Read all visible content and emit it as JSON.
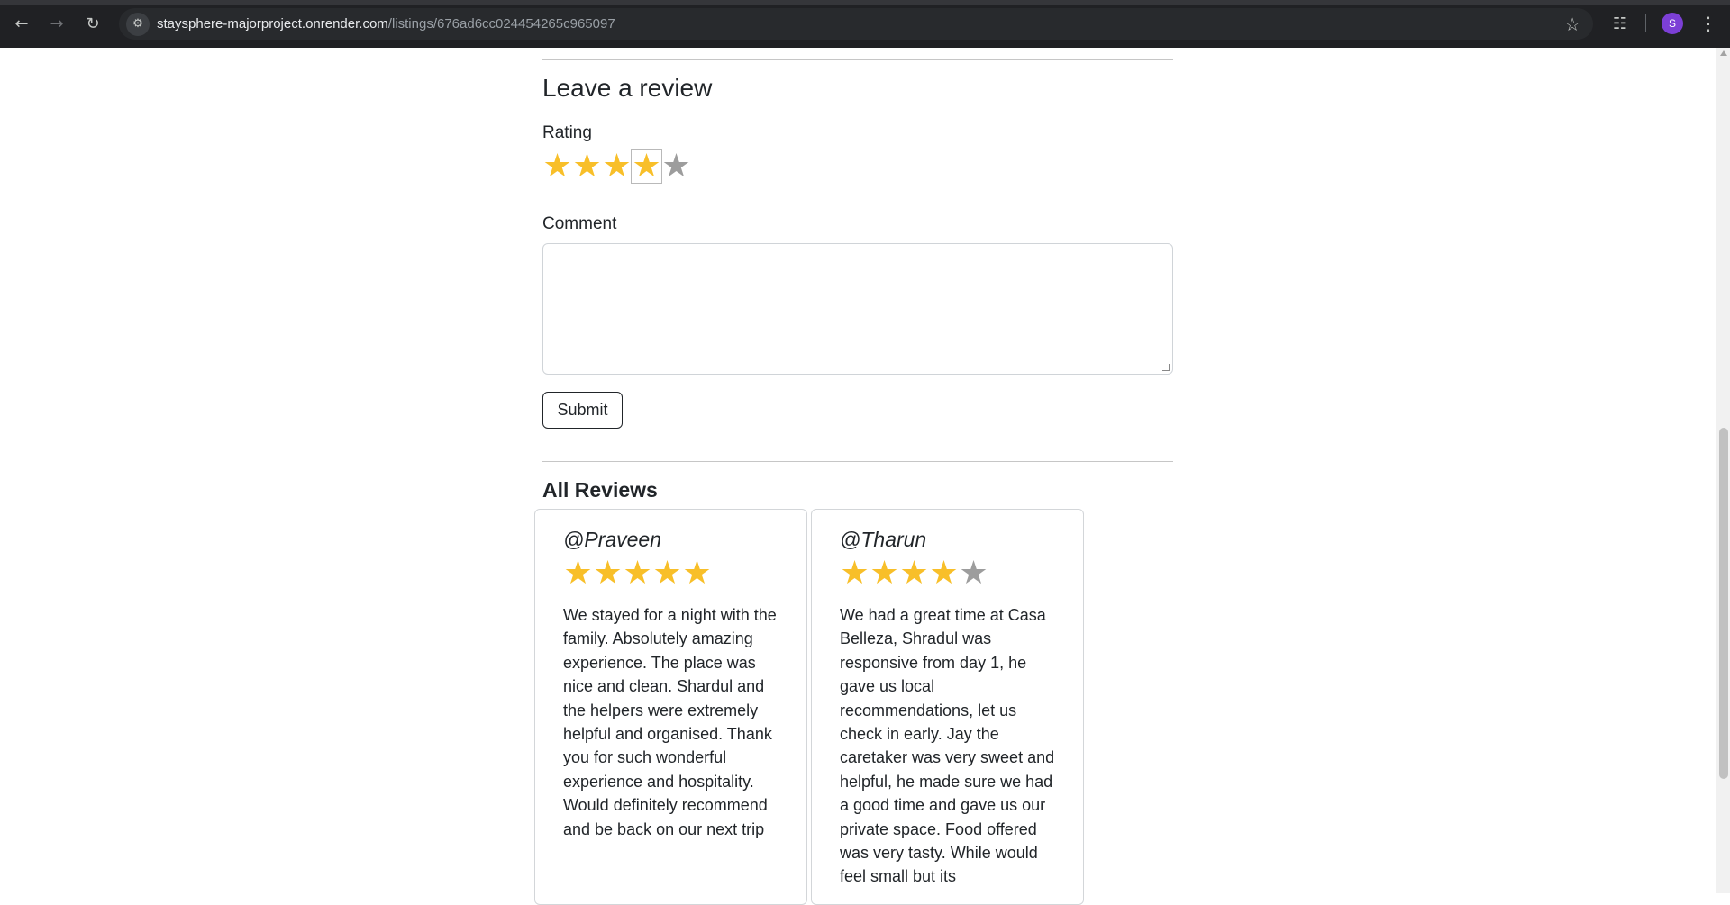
{
  "browser": {
    "url_host": "staysphere-majorproject.onrender.com",
    "url_path": "/listings/676ad6cc024454265c965097",
    "profile_initial": "S"
  },
  "review_form": {
    "heading": "Leave a review",
    "rating_label": "Rating",
    "rating_value": 4,
    "rating_max": 5,
    "comment_label": "Comment",
    "comment_value": "",
    "submit_label": "Submit"
  },
  "reviews_section": {
    "heading": "All Reviews",
    "reviews": [
      {
        "author": "@Praveen",
        "rating": 5,
        "comment": "We stayed for a night with the family. Absolutely amazing experience. The place was nice and clean. Shardul and the helpers were extremely helpful and organised. Thank you for such wonderful experience and hospitality. Would definitely recommend and be back on our next trip"
      },
      {
        "author": "@Tharun",
        "rating": 4,
        "comment": "We had a great time at Casa Belleza, Shradul was responsive from day 1, he gave us local recommendations, let us check in early. Jay the caretaker was very sweet and helpful, he made sure we had a good time and gave us our private space. Food offered was very tasty. While would feel small but its"
      }
    ]
  },
  "colors": {
    "star_on": "#f8bf29",
    "star_off": "#9d9d9d"
  }
}
